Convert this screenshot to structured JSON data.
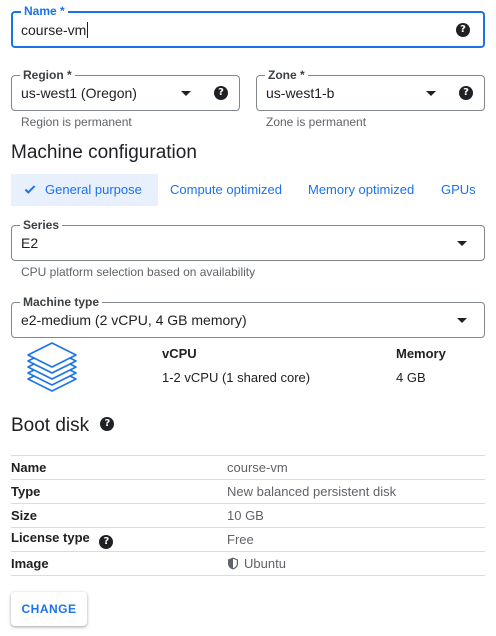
{
  "name": {
    "label": "Name *",
    "value": "course-vm"
  },
  "region": {
    "label": "Region *",
    "value": "us-west1 (Oregon)",
    "hint": "Region is permanent"
  },
  "zone": {
    "label": "Zone *",
    "value": "us-west1-b",
    "hint": "Zone is permanent"
  },
  "machine_config": {
    "title": "Machine configuration",
    "tabs": [
      {
        "label": "General purpose",
        "selected": true
      },
      {
        "label": "Compute optimized",
        "selected": false
      },
      {
        "label": "Memory optimized",
        "selected": false
      },
      {
        "label": "GPUs",
        "selected": false
      }
    ],
    "series": {
      "label": "Series",
      "value": "E2",
      "hint": "CPU platform selection based on availability"
    },
    "machine_type": {
      "label": "Machine type",
      "value": "e2-medium (2 vCPU, 4 GB memory)"
    },
    "specs": {
      "vcpu_header": "vCPU",
      "vcpu_value": "1-2 vCPU (1 shared core)",
      "memory_header": "Memory",
      "memory_value": "4 GB"
    }
  },
  "boot_disk": {
    "title": "Boot disk",
    "rows": [
      {
        "key": "Name",
        "value": "course-vm"
      },
      {
        "key": "Type",
        "value": "New balanced persistent disk"
      },
      {
        "key": "Size",
        "value": "10 GB"
      },
      {
        "key": "License type",
        "value": "Free"
      },
      {
        "key": "Image",
        "value": "Ubuntu"
      }
    ],
    "change_label": "CHANGE"
  },
  "icons": {
    "help": "help-icon",
    "dropdown": "dropdown-arrow-icon",
    "check": "check-icon",
    "stack": "layers-icon",
    "shield": "shield-icon"
  },
  "colors": {
    "accent": "#1a73e8",
    "tab_selected_bg": "#e8f0fe",
    "text": "#202124",
    "muted": "#5f6368"
  }
}
